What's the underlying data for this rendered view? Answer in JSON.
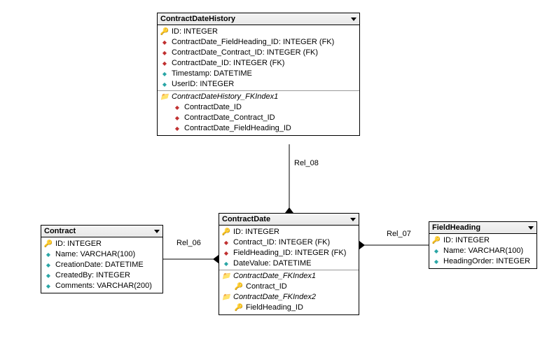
{
  "entities": {
    "contractDateHistory": {
      "title": "ContractDateHistory",
      "rows": [
        {
          "icon": "key",
          "text": "ID: INTEGER"
        },
        {
          "icon": "fk",
          "text": "ContractDate_FieldHeading_ID: INTEGER (FK)"
        },
        {
          "icon": "fk",
          "text": "ContractDate_Contract_ID: INTEGER (FK)"
        },
        {
          "icon": "fk",
          "text": "ContractDate_ID: INTEGER (FK)"
        },
        {
          "icon": "col",
          "text": "Timestamp: DATETIME"
        },
        {
          "icon": "col",
          "text": "UserID: INTEGER"
        }
      ],
      "index": {
        "name": "ContractDateHistory_FKIndex1",
        "cols": [
          "ContractDate_ID",
          "ContractDate_Contract_ID",
          "ContractDate_FieldHeading_ID"
        ]
      }
    },
    "contract": {
      "title": "Contract",
      "rows": [
        {
          "icon": "key",
          "text": "ID: INTEGER"
        },
        {
          "icon": "col",
          "text": "Name: VARCHAR(100)"
        },
        {
          "icon": "col",
          "text": "CreationDate: DATETIME"
        },
        {
          "icon": "col",
          "text": "CreatedBy: INTEGER"
        },
        {
          "icon": "col",
          "text": "Comments: VARCHAR(200)"
        }
      ]
    },
    "contractDate": {
      "title": "ContractDate",
      "rows": [
        {
          "icon": "key",
          "text": "ID: INTEGER"
        },
        {
          "icon": "fk",
          "text": "Contract_ID: INTEGER (FK)"
        },
        {
          "icon": "fk",
          "text": "FieldHeading_ID: INTEGER (FK)"
        },
        {
          "icon": "col",
          "text": "DateValue: DATETIME"
        }
      ],
      "indexes": [
        {
          "name": "ContractDate_FKIndex1",
          "cols": [
            "Contract_ID"
          ]
        },
        {
          "name": "ContractDate_FKIndex2",
          "cols": [
            "FieldHeading_ID"
          ]
        }
      ]
    },
    "fieldHeading": {
      "title": "FieldHeading",
      "rows": [
        {
          "icon": "key",
          "text": "ID: INTEGER"
        },
        {
          "icon": "col",
          "text": "Name: VARCHAR(100)"
        },
        {
          "icon": "col",
          "text": "HeadingOrder: INTEGER"
        }
      ]
    }
  },
  "relations": {
    "rel06": "Rel_06",
    "rel07": "Rel_07",
    "rel08": "Rel_08"
  }
}
